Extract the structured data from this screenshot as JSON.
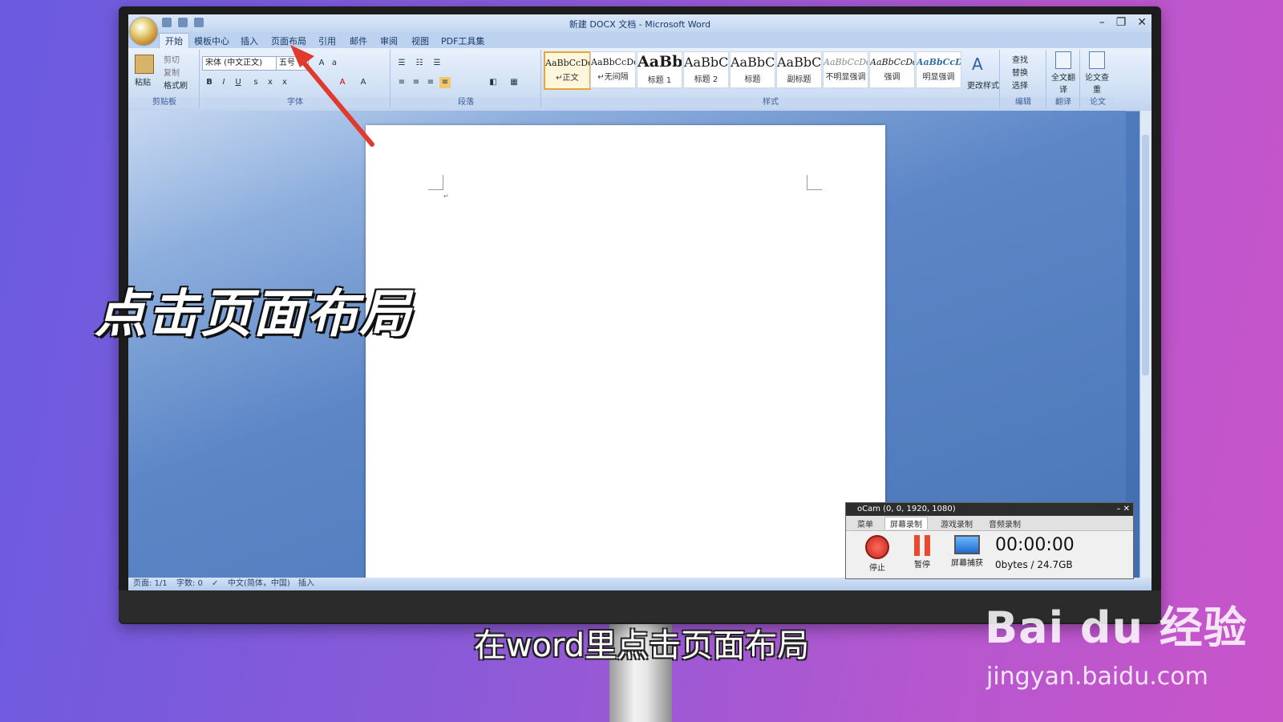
{
  "window": {
    "title": "新建 DOCX 文档 - Microsoft Word"
  },
  "tabs": [
    "开始",
    "模板中心",
    "插入",
    "页面布局",
    "引用",
    "邮件",
    "审阅",
    "视图",
    "PDF工具集"
  ],
  "ribbon": {
    "clipboard": {
      "paste": "粘贴",
      "cut": "剪切",
      "copy": "复制",
      "format_painter": "格式刷",
      "label": "剪贴板"
    },
    "font": {
      "name": "宋体 (中文正文)",
      "size": "五号",
      "label": "字体"
    },
    "paragraph": {
      "label": "段落"
    },
    "styles": {
      "label": "样式",
      "items": [
        {
          "sample": "AaBbCcDd",
          "name": "↵正文"
        },
        {
          "sample": "AaBbCcDd",
          "name": "↵无间隔"
        },
        {
          "sample": "AaBb",
          "name": "标题 1"
        },
        {
          "sample": "AaBbC",
          "name": "标题 2"
        },
        {
          "sample": "AaBbC",
          "name": "标题"
        },
        {
          "sample": "AaBbC",
          "name": "副标题"
        },
        {
          "sample": "AaBbCcDd",
          "name": "不明显强调"
        },
        {
          "sample": "AaBbCcDd",
          "name": "强调"
        },
        {
          "sample": "AaBbCcDd",
          "name": "明显强调"
        }
      ],
      "change": "更改样式"
    },
    "editing": {
      "find": "查找",
      "replace": "替换",
      "select": "选择",
      "label": "编辑"
    },
    "translate": {
      "full": "全文翻译",
      "label": "翻译"
    },
    "paper": {
      "check": "论文查重",
      "label": "论文"
    }
  },
  "statusbar": {
    "page": "页面: 1/1",
    "words": "字数: 0",
    "lang": "中文(简体，中国)",
    "mode": "插入"
  },
  "ocam": {
    "title": "oCam (0, 0, 1920, 1080)",
    "tabs": [
      "菜单",
      "屏幕录制",
      "游戏录制",
      "音频录制"
    ],
    "buttons": [
      "停止",
      "暂停",
      "屏幕捕获"
    ],
    "timer": "00:00:00",
    "size": "0bytes / 24.7GB"
  },
  "overlay": {
    "caption": "点击页面布局",
    "subtitle": "在word里点击页面布局",
    "watermark_logo": "Bai du 经验",
    "watermark_url": "jingyan.baidu.com"
  },
  "colors": {
    "arrow": "#e03a2e",
    "ribbon_accent": "#e8a43a"
  }
}
